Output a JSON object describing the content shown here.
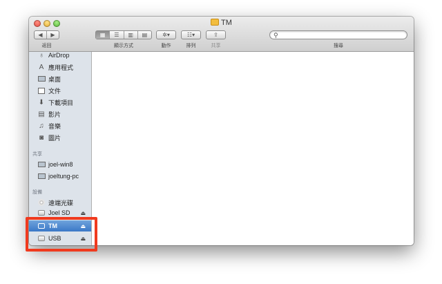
{
  "window": {
    "title": "TM"
  },
  "toolbar": {
    "back_label": "返回",
    "view_label": "顯示方式",
    "action_label": "動作",
    "arrange_label": "排列",
    "share_label": "共享",
    "search_label": "搜尋",
    "search_placeholder": ""
  },
  "sidebar": {
    "favorites": [
      {
        "label": "AirDrop",
        "icon": "airdrop-icon"
      },
      {
        "label": "應用程式",
        "icon": "applications-icon"
      },
      {
        "label": "桌面",
        "icon": "desktop-icon"
      },
      {
        "label": "文件",
        "icon": "documents-icon"
      },
      {
        "label": "下載項目",
        "icon": "downloads-icon"
      },
      {
        "label": "影片",
        "icon": "movies-icon"
      },
      {
        "label": "音樂",
        "icon": "music-icon"
      },
      {
        "label": "圖片",
        "icon": "pictures-icon"
      }
    ],
    "shared_header": "共享",
    "shared": [
      {
        "label": "joel-win8",
        "icon": "computer-icon"
      },
      {
        "label": "joeltung-pc",
        "icon": "computer-icon"
      }
    ],
    "devices_header": "設備",
    "devices": [
      {
        "label": "遠端光碟",
        "icon": "remote-disc-icon"
      },
      {
        "label": "Joel SD",
        "icon": "sd-card-icon"
      },
      {
        "label": "TM",
        "icon": "external-drive-icon",
        "selected": true
      },
      {
        "label": "USB",
        "icon": "external-drive-icon"
      }
    ]
  },
  "colors": {
    "selection": "#3b78c7",
    "highlight_box": "#f03a1e",
    "sidebar_bg": "#dde3ea"
  }
}
